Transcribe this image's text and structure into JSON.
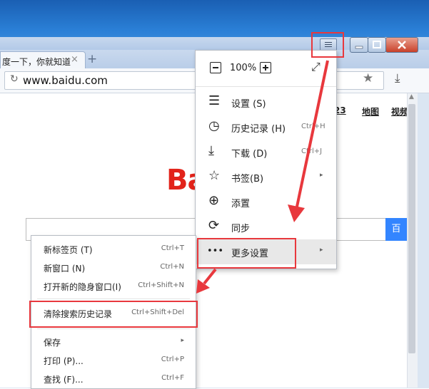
{
  "browser": {
    "tab_title": "度一下，你就知道",
    "tab_close": "×",
    "new_tab": "+",
    "reload_glyph": "↻",
    "url": "www.baidu.com",
    "star_glyph": "★",
    "download_glyph": "⤓"
  },
  "page": {
    "nav_links": [
      "23",
      "地图",
      "视频"
    ],
    "logo_text": "Ba",
    "search_button_label": "百"
  },
  "main_menu": {
    "zoom_value": "100%",
    "fullscreen_glyph": "⤢",
    "items": [
      {
        "label": "设置 (S)",
        "shortcut": "",
        "arrow": "",
        "icon": "settings-sliders-icon",
        "glyph": "☰"
      },
      {
        "label": "历史记录 (H)",
        "shortcut": "Ctrl+H",
        "arrow": "",
        "icon": "clock-icon",
        "glyph": "◷"
      },
      {
        "label": "下载 (D)",
        "shortcut": "Ctrl+J",
        "arrow": "",
        "icon": "download-icon",
        "glyph": "⤓"
      },
      {
        "label": "书签(B)",
        "shortcut": "",
        "arrow": "▸",
        "icon": "star-outline-icon",
        "glyph": "☆"
      },
      {
        "label": "添置",
        "shortcut": "",
        "arrow": "",
        "icon": "plus-circle-icon",
        "glyph": "⊕"
      },
      {
        "label": "同步",
        "shortcut": "",
        "arrow": "",
        "icon": "sync-icon",
        "glyph": "⟳"
      },
      {
        "label": "更多设置",
        "shortcut": "",
        "arrow": "▸",
        "icon": "more-dots-icon",
        "glyph": "•••"
      }
    ]
  },
  "sub_menu": {
    "items": [
      {
        "label": "新标签页 (T)",
        "shortcut": "Ctrl+T",
        "arrow": ""
      },
      {
        "label": "新窗口 (N)",
        "shortcut": "Ctrl+N",
        "arrow": ""
      },
      {
        "label": "打开新的隐身窗口(I)",
        "shortcut": "Ctrl+Shift+N",
        "arrow": ""
      },
      {
        "label": "清除搜索历史记录",
        "shortcut": "Ctrl+Shift+Del",
        "arrow": ""
      },
      {
        "label": "保存",
        "shortcut": "",
        "arrow": "▸"
      },
      {
        "label": "打印 (P)...",
        "shortcut": "Ctrl+P",
        "arrow": ""
      },
      {
        "label": "查找 (F)...",
        "shortcut": "Ctrl+F",
        "arrow": ""
      }
    ]
  },
  "colors": {
    "highlight": "#e8383d",
    "logo": "#e2231a",
    "search_button": "#3385ff"
  }
}
